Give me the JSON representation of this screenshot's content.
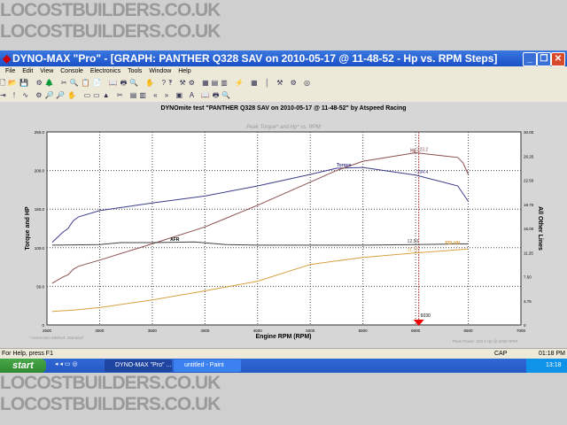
{
  "watermark": "LOCOSTBUILDERS.CO.UK",
  "window": {
    "title": "DYNO-MAX \"Pro\" - [GRAPH: PANTHER Q328 SAV  on 2010-05-17 @ 11-48-52 - Hp vs. RPM Steps]"
  },
  "menu": [
    "File",
    "Edit",
    "View",
    "Console",
    "Electronics",
    "Tools",
    "Window",
    "Help"
  ],
  "toolbar1": "🗋📂💾 ⚙🌲 ✂🔍📋📄 📖🖶🔍 ✋ ?‽ ⚒⚙ ▦▤▥ ⚡ ▦ │ ⚒ ⚙ ◎",
  "toolbar2": "⇥ ! ∿ ⚙🔎🔎✋ ▭▭▲ ✂ ▤▥ « » ▣ A 📖🖶🔍",
  "status": {
    "help": "For Help, press F1",
    "cap": "CAP",
    "time": "01:18 PM"
  },
  "taskbar": {
    "start": "start",
    "tasks": [
      "DYNO-MAX \"Pro\" ...",
      "untitled - Paint"
    ],
    "clock": "13:18"
  },
  "chart_data": {
    "type": "line",
    "title": "DYNOmite test \"PANTHER Q328 SAV  on 2010-05-17 @ 11-48-52\" by Atspeed Racing",
    "subtitle": "Peak Torque* and Hp* vs. RPM",
    "xlabel": "Engine RPM (RPM)",
    "ylabel": "Torque and HP",
    "y2label": "All Other Lines",
    "xlim": [
      2500,
      7000
    ],
    "ylim": [
      0,
      250
    ],
    "y2lim": [
      0,
      30
    ],
    "xticks": [
      "2500",
      "3000",
      "3500",
      "4000",
      "4500",
      "5000",
      "5500",
      "6000",
      "6500",
      "7000"
    ],
    "yticks": [
      "0",
      "50.0",
      "100.0",
      "150.0",
      "200.0",
      "250.0"
    ],
    "y2ticks": [
      "0",
      "3.75",
      "7.50",
      "11.25",
      "15.00",
      "18.75",
      "22.50",
      "26.25",
      "30.00"
    ],
    "footnote": "* Correction Method: Standard",
    "peak_note": "Peak Power: 223.4 Hp @ 6000 RPM",
    "cursor": {
      "rpm": 6030,
      "label": "6030"
    },
    "series": [
      {
        "name": "Torque",
        "axis": "left",
        "color": "#3c3c8c",
        "x": [
          2550,
          2650,
          2700,
          2750,
          2800,
          3000,
          3500,
          4000,
          4500,
          5000,
          5250,
          5500,
          6000,
          6400,
          6500
        ],
        "y": [
          107,
          120,
          125,
          135,
          140,
          148,
          158,
          167,
          180,
          195,
          203,
          204,
          194,
          180,
          160
        ],
        "value_label": "194.4"
      },
      {
        "name": "Hp",
        "axis": "left",
        "color": "#8c5050",
        "x": [
          2550,
          2650,
          2700,
          2750,
          2800,
          3000,
          3500,
          4000,
          4500,
          5000,
          5250,
          5500,
          6000,
          6400,
          6450,
          6500
        ],
        "y": [
          54,
          62,
          65,
          72,
          76,
          84,
          105,
          127,
          155,
          185,
          200,
          212,
          223,
          217,
          210,
          195
        ],
        "value_label": "223.2"
      },
      {
        "name": "AFR",
        "axis": "right",
        "color": "#404040",
        "x": [
          2550,
          3000,
          3200,
          3500,
          3900,
          4200,
          4500,
          5000,
          5500,
          6000,
          6500
        ],
        "y": [
          12.4,
          12.5,
          12.8,
          12.8,
          12.9,
          12.5,
          12.4,
          12.4,
          12.4,
          12.5,
          12.6
        ],
        "value_label": "12.50"
      },
      {
        "name": "PSI-HH",
        "axis": "right",
        "color": "#d8a040",
        "x": [
          2550,
          2750,
          3000,
          3500,
          4000,
          4500,
          5000,
          5500,
          6000,
          6500
        ],
        "y": [
          2.1,
          2.3,
          2.7,
          3.9,
          5.3,
          6.8,
          9.4,
          10.5,
          11.2,
          11.8
        ],
        "value_label": "11.72"
      }
    ]
  }
}
